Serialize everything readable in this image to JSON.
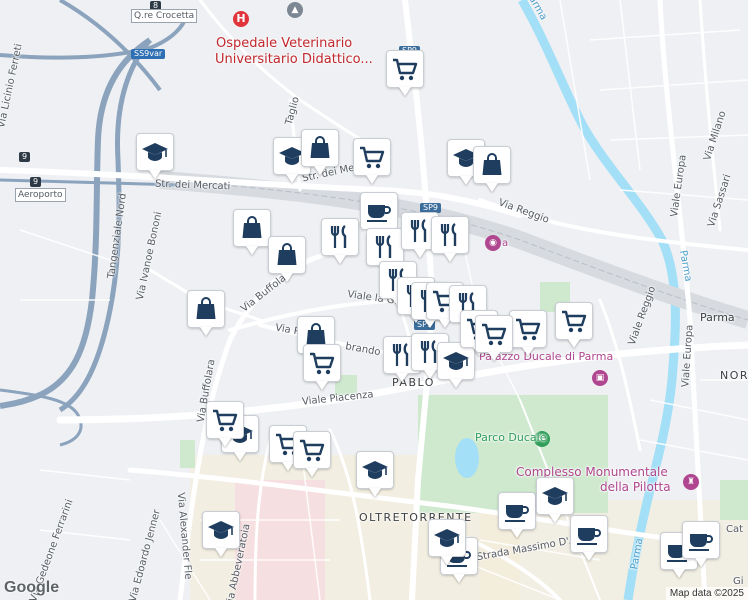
{
  "map": {
    "attribution": "Map data ©2025",
    "logo": "Google",
    "colors": {
      "water": "#a3dff7",
      "park": "#cfe9cf",
      "road": "#ffffff",
      "highway": "#8ba3bd",
      "pin_icon": "#1f3d5e",
      "hospital": "#e0353b",
      "attraction": "#b0468f"
    }
  },
  "labels": {
    "crocetta": "Q.re Crocetta",
    "hospital": "Ospedale Veterinario",
    "hospital2": "Universitario Didattico...",
    "mercati": "Str. dei Mercati",
    "mercati2": "Str. dei Me",
    "aeroporto": "Aeroporto",
    "ferreti": "Via Licinio Ferreti",
    "tangenziale": "Tangenziale Nord",
    "bononi": "Via Ivanoe Bononi",
    "taglio": "Taglio",
    "buffolara": "Via Buffolara",
    "buffolara2": "Via Buffolara",
    "grotta": "Viale la Grotta",
    "pa": "Via Pa",
    "ildebrando": "brando B",
    "piacenza": "Viale Piacenza",
    "reggio": "Via Reggio",
    "reggio2": "Viale Reggio",
    "europa": "Viale Europa",
    "europa2": "Viale Europa",
    "milano": "Via Milano",
    "sassari": "Via Sassari",
    "parma_river": "Parma",
    "parma_river2": "Parma",
    "parma_river3": "Parma",
    "parma_station": "Parma",
    "pablo": "PABLO",
    "palazzo": "Palazzo Ducale di Parma",
    "parco": "Parco Ducale",
    "complesso": "Complesso Monumentale",
    "complesso2": "della Pilotta",
    "oltretorrente": "OLTRETORRENTE",
    "azeglio": "Strada Massimo D'Azeglio",
    "ferrarini": "Via Gedeone Ferrarini",
    "jenner": "Via Edoardo Jenner",
    "alexander": "Via Alexander Fle",
    "abbeveratoia": "Via Abbeveratoia",
    "norte": "NOR",
    "cat": "Cat",
    "gi": "Gi",
    "station_a": "a"
  },
  "shields": {
    "ss9var": "SS9var",
    "n8": "8",
    "n9a": "9",
    "n9b": "9",
    "sp9a": "SP9",
    "sp9b": "SP9",
    "sp9c": "SP9"
  },
  "pins": [
    {
      "id": "cart-1",
      "type": "cart"
    },
    {
      "id": "edu-1",
      "type": "edu"
    },
    {
      "id": "edu-2",
      "type": "edu"
    },
    {
      "id": "bag-1",
      "type": "bag"
    },
    {
      "id": "cart-2",
      "type": "cart"
    },
    {
      "id": "edu-3",
      "type": "edu"
    },
    {
      "id": "bag-2",
      "type": "bag"
    },
    {
      "id": "bag-3",
      "type": "bag"
    },
    {
      "id": "bag-4",
      "type": "bag"
    },
    {
      "id": "food-1",
      "type": "food"
    },
    {
      "id": "coffee-0",
      "type": "coffee"
    },
    {
      "id": "food-2",
      "type": "food"
    },
    {
      "id": "food-3",
      "type": "food"
    },
    {
      "id": "food-4",
      "type": "food"
    },
    {
      "id": "food-5",
      "type": "food"
    },
    {
      "id": "food-6",
      "type": "food"
    },
    {
      "id": "food-7",
      "type": "food"
    },
    {
      "id": "cart-3",
      "type": "cart"
    },
    {
      "id": "food-8",
      "type": "food"
    },
    {
      "id": "bag-5",
      "type": "bag"
    },
    {
      "id": "bag-6",
      "type": "bag"
    },
    {
      "id": "cart-4",
      "type": "cart"
    },
    {
      "id": "cart-5",
      "type": "cart"
    },
    {
      "id": "cart-6",
      "type": "cart"
    },
    {
      "id": "food-9",
      "type": "food"
    },
    {
      "id": "food-10",
      "type": "food"
    },
    {
      "id": "edu-4",
      "type": "edu"
    },
    {
      "id": "cart-7",
      "type": "cart"
    },
    {
      "id": "cart-8",
      "type": "cart"
    },
    {
      "id": "edu-5",
      "type": "edu"
    },
    {
      "id": "cart-9",
      "type": "cart"
    },
    {
      "id": "cart-10",
      "type": "cart"
    },
    {
      "id": "cart-11",
      "type": "cart"
    },
    {
      "id": "edu-6",
      "type": "edu"
    },
    {
      "id": "coffee-1",
      "type": "coffee"
    },
    {
      "id": "edu-7",
      "type": "edu"
    },
    {
      "id": "edu-8",
      "type": "edu"
    },
    {
      "id": "coffee-2",
      "type": "coffee"
    },
    {
      "id": "coffee-3",
      "type": "coffee"
    },
    {
      "id": "coffee-4",
      "type": "coffee"
    },
    {
      "id": "coffee-5",
      "type": "coffee"
    },
    {
      "id": "edu-9",
      "type": "edu"
    }
  ]
}
